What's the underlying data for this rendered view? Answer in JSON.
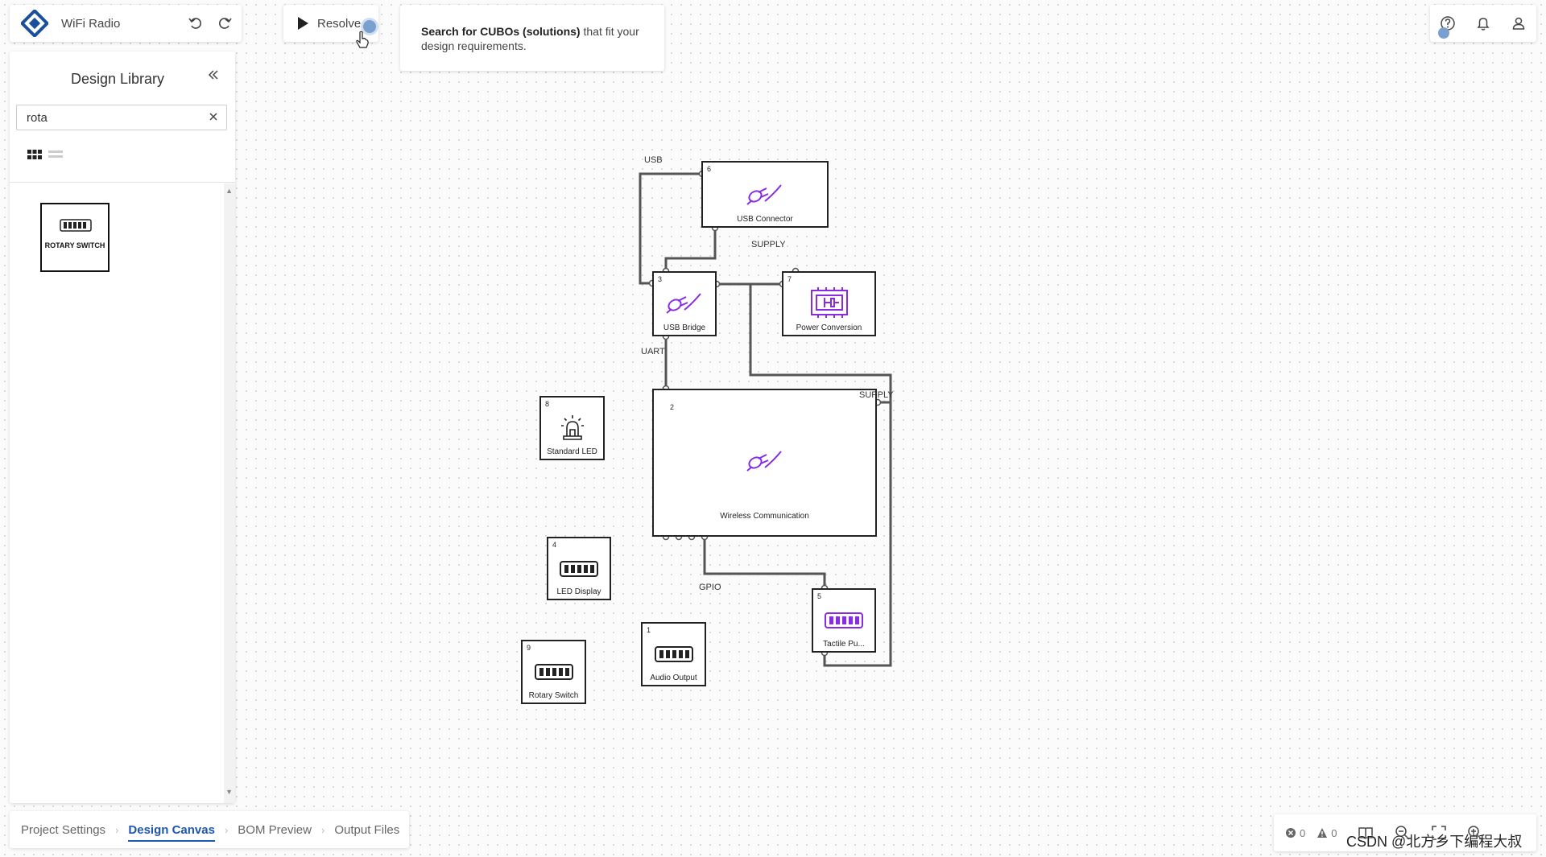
{
  "header": {
    "project_title": "WiFi Radio",
    "resolve_label": "Resolve"
  },
  "tooltip": {
    "bold": "Search for CUBOs (solutions)",
    "rest": " that fit your design requirements."
  },
  "sidebar": {
    "title": "Design Library",
    "search_value": "rota",
    "results": [
      {
        "label": "ROTARY SWITCH"
      }
    ]
  },
  "canvas": {
    "blocks": [
      {
        "num": "6",
        "label": "USB Connector",
        "icon": "plug-icon"
      },
      {
        "num": "3",
        "label": "USB Bridge",
        "icon": "plug-icon"
      },
      {
        "num": "7",
        "label": "Power Conversion",
        "icon": "chip-icon"
      },
      {
        "num": "2",
        "label": "Wireless Communication",
        "icon": "plug-icon"
      },
      {
        "num": "8",
        "label": "Standard LED",
        "icon": "led-icon"
      },
      {
        "num": "4",
        "label": "LED Display",
        "icon": "connector-icon"
      },
      {
        "num": "5",
        "label": "Tactile Pu...",
        "icon": "connector-icon"
      },
      {
        "num": "1",
        "label": "Audio Output",
        "icon": "connector-icon"
      },
      {
        "num": "9",
        "label": "Rotary Switch",
        "icon": "connector-icon"
      }
    ],
    "net_labels": {
      "usb": "USB",
      "supply_top": "SUPPLY",
      "uart": "UART",
      "supply_right": "SUPPLY",
      "gpio": "GPIO"
    }
  },
  "breadcrumb": [
    {
      "label": "Project Settings"
    },
    {
      "label": "Design Canvas"
    },
    {
      "label": "BOM Preview"
    },
    {
      "label": "Output Files"
    }
  ],
  "status": {
    "errors": "0",
    "warnings": "0"
  },
  "watermark": "CSDN @北方乡下编程大叔",
  "colors": {
    "accent": "#1e56b0",
    "icon_purple": "#8a2be2",
    "logo_blue": "#1a4f9c"
  }
}
